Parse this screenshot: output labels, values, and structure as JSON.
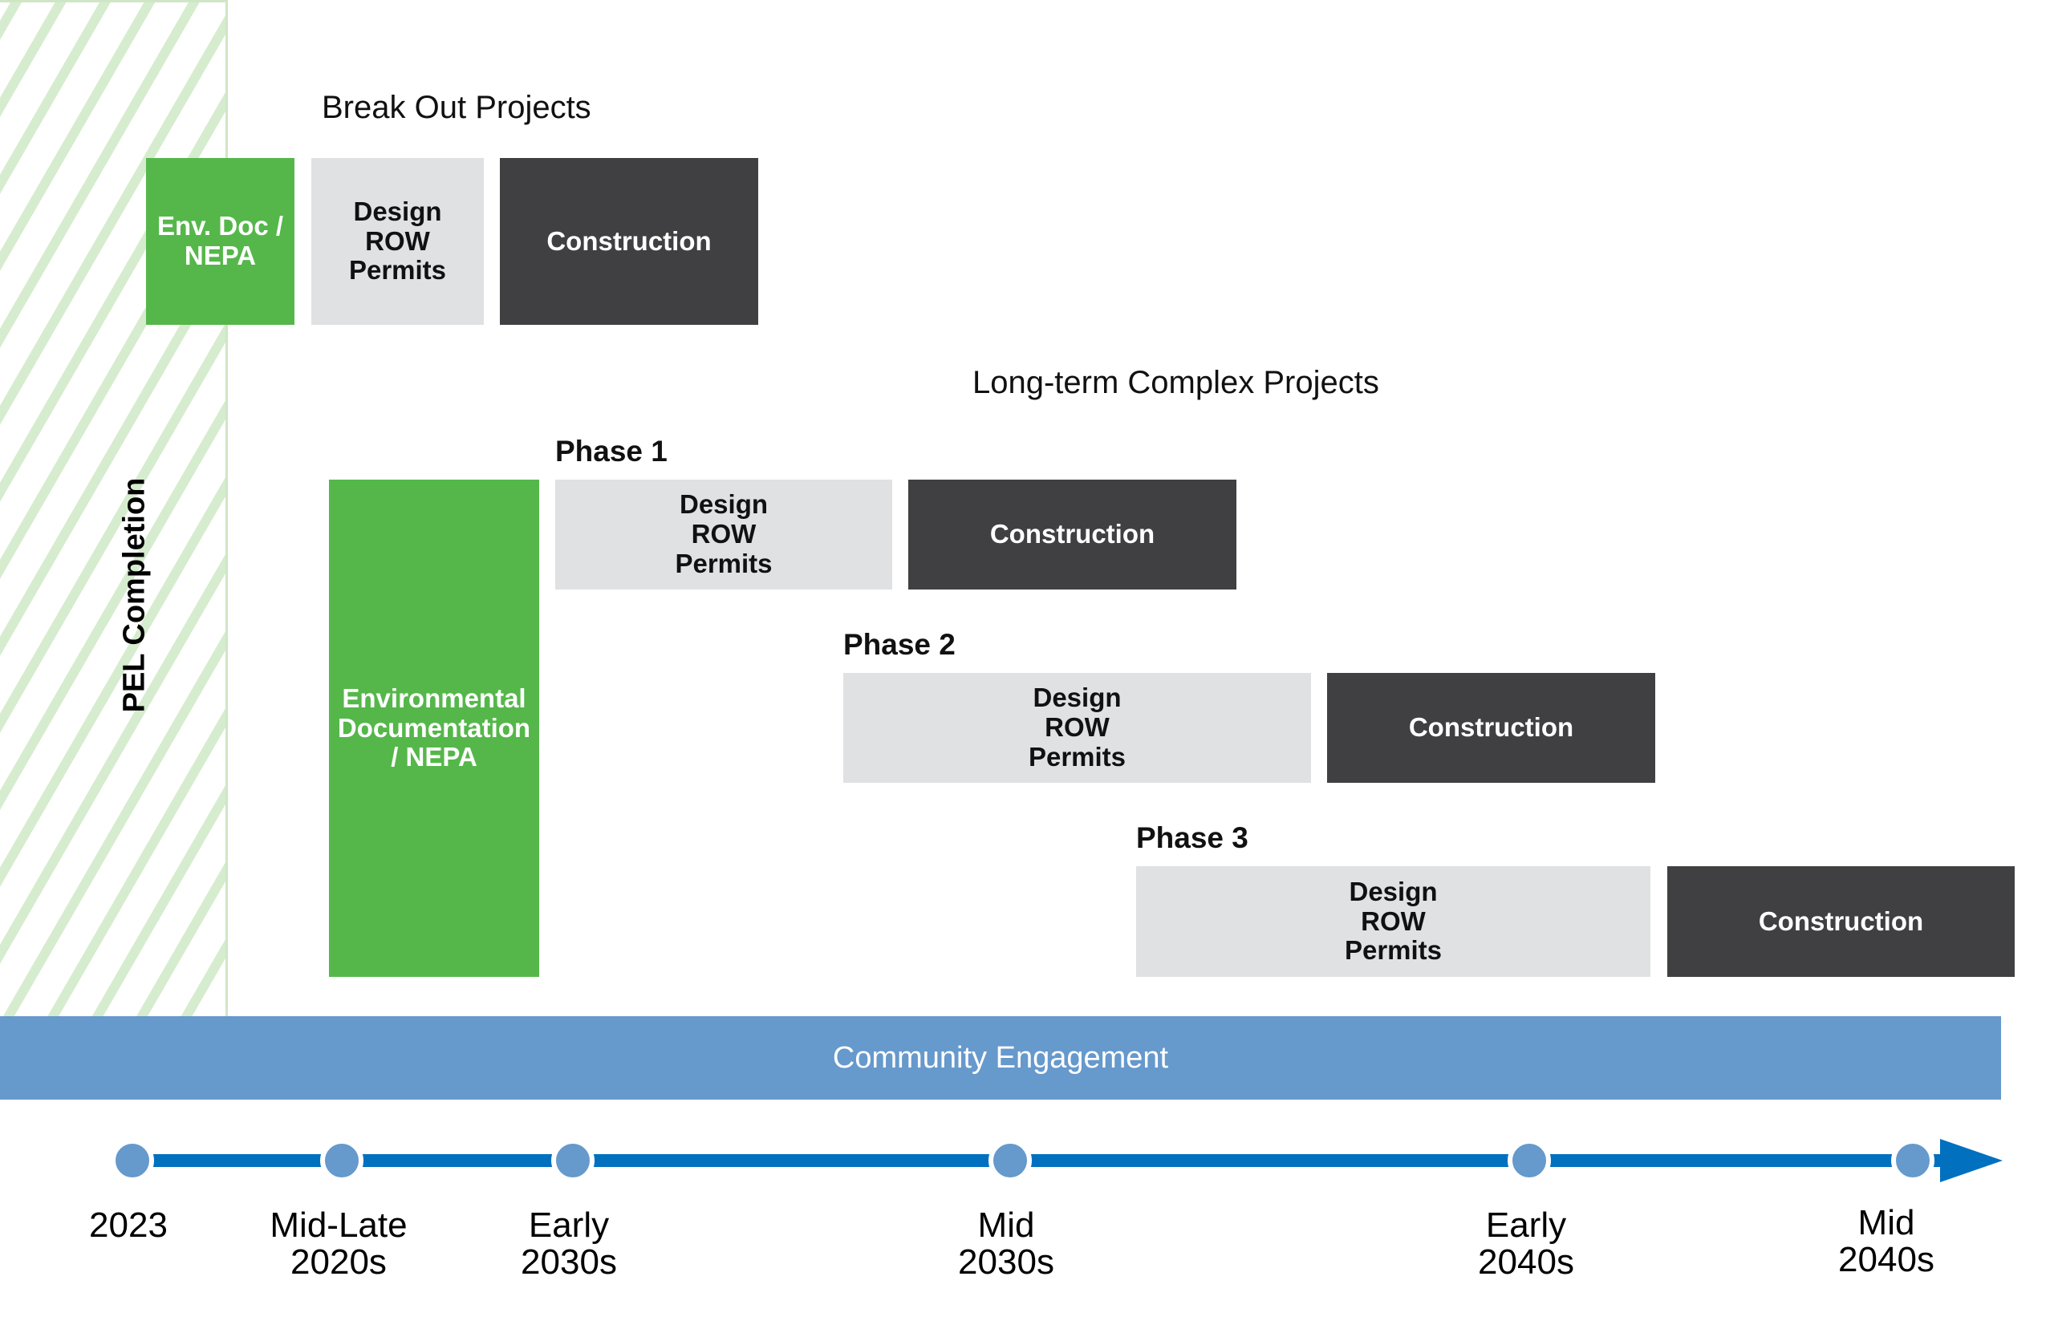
{
  "pel": {
    "label": "PEL Completion",
    "hatch_color": "#d6ecce"
  },
  "break_out": {
    "title": "Break Out Projects",
    "boxes": [
      {
        "label": "Env. Doc /\nNEPA",
        "kind": "environmental"
      },
      {
        "label": "Design\nROW\nPermits",
        "kind": "design"
      },
      {
        "label": "Construction",
        "kind": "construction"
      }
    ]
  },
  "long_term": {
    "title": "Long-term Complex Projects",
    "env_box": "Environmental\nDocumentation\n/ NEPA",
    "phases": [
      {
        "label": "Phase 1",
        "design": "Design\nROW\nPermits",
        "construction": "Construction"
      },
      {
        "label": "Phase 2",
        "design": "Design\nROW\nPermits",
        "construction": "Construction"
      },
      {
        "label": "Phase 3",
        "design": "Design\nROW\nPermits",
        "construction": "Construction"
      }
    ]
  },
  "community": {
    "label": "Community Engagement"
  },
  "timeline": {
    "milestones": [
      "2023",
      "Mid-Late\n2020s",
      "Early\n2030s",
      "Mid\n2030s",
      "Early\n2040s",
      "Mid\n2040s"
    ]
  },
  "colors": {
    "environmental": "#55b74a",
    "design": "#e0e1e3",
    "construction": "#404042",
    "community": "#6699cc",
    "timeline": "#0070bf"
  }
}
